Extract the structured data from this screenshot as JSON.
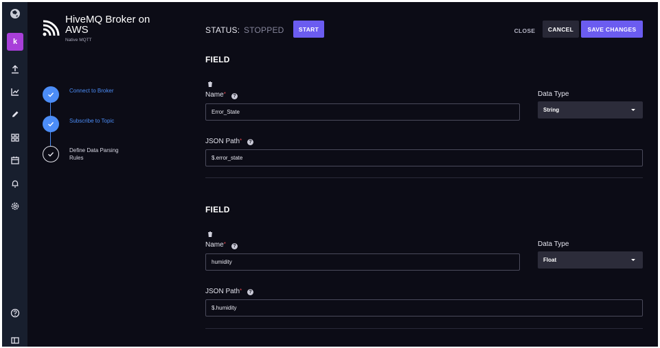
{
  "rail": {
    "avatar_letter": "k",
    "icons": [
      "globe-icon",
      "upload-icon",
      "chart-icon",
      "pencil-icon",
      "dashboard-icon",
      "calendar-icon",
      "bell-icon",
      "settings-icon",
      "help-icon",
      "sidebar-toggle-icon"
    ]
  },
  "integration": {
    "title": "HiveMQ Broker on AWS",
    "subtitle": "Native MQTT",
    "steps": [
      {
        "label": "Connect to Broker",
        "state": "done"
      },
      {
        "label": "Subscribe to Topic",
        "state": "done"
      },
      {
        "label": "Define Data Parsing Rules",
        "state": "current"
      }
    ]
  },
  "header": {
    "status_label": "STATUS:",
    "status_value": "STOPPED",
    "start_label": "START",
    "close_label": "CLOSE",
    "cancel_label": "CANCEL",
    "save_label": "SAVE CHANGES"
  },
  "fields": [
    {
      "heading": "FIELD",
      "name_label": "Name",
      "name_value": "Error_State",
      "type_label": "Data Type",
      "type_value": "String",
      "path_label": "JSON Path",
      "path_value": "$.error_state"
    },
    {
      "heading": "FIELD",
      "name_label": "Name",
      "name_value": "humidity",
      "type_label": "Data Type",
      "type_value": "Float",
      "path_label": "JSON Path",
      "path_value": "$.humidity"
    }
  ],
  "required_marker": "*",
  "help_marker": "?",
  "colors": {
    "accent": "#6b5cf0",
    "step_done": "#4c8df7",
    "required": "#e2474f",
    "background": "#0c0c16",
    "rail": "#181f2e"
  }
}
